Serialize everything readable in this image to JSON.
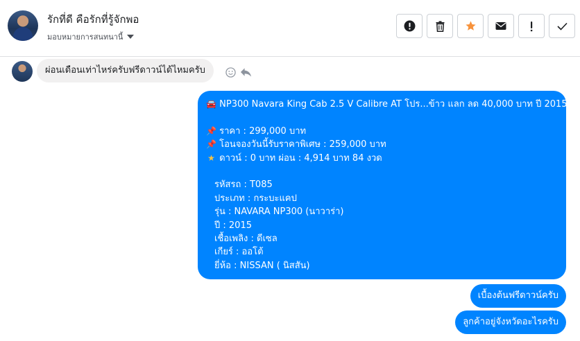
{
  "header": {
    "contact_name": "รักที่ดี คือรักที่รู้จักพอ",
    "assign_label": "มอบหมายการสนทนานี้",
    "actions": [
      {
        "name": "spam-button",
        "icon": "exclamation-circle-icon",
        "glyph": "❗"
      },
      {
        "name": "delete-button",
        "icon": "trash-icon",
        "glyph": "🗑"
      },
      {
        "name": "star-button",
        "icon": "star-icon",
        "glyph": "★"
      },
      {
        "name": "mark-unread-button",
        "icon": "envelope-icon",
        "glyph": "✉"
      },
      {
        "name": "follow-up-button",
        "icon": "exclamation-icon",
        "glyph": "!"
      },
      {
        "name": "done-button",
        "icon": "check-icon",
        "glyph": "✓"
      }
    ],
    "star_color": "#f7923b"
  },
  "thread": {
    "incoming": {
      "text": "ผ่อนเดือนเท่าไหร่ครับฟรีดาวน์ได้ไหมครับ",
      "icons": [
        "smiley-icon",
        "reply-icon"
      ]
    },
    "listing": {
      "title_icon": "car-icon",
      "title": "NP300 Navara King Cab 2.5 V Calibre AT โปร...ข้าว แลก ลด 40,000 บาท ปี 2015",
      "price_icon": "pushpin-icon",
      "price": "ราคา : 299,000 บาท",
      "special_icon": "pushpin-icon",
      "special": "โอนจองวันนี้รับราคาพิเศษ : 259,000 บาท",
      "down_icon": "star-icon",
      "down": "ดาวน์ : 0 บาท ผ่อน : 4,914 บาท 84 งวด",
      "details": [
        "รหัสรถ : T085",
        "ประเภท : กระบะแคป",
        "รุ่น : NAVARA NP300 (นาวาร่า)",
        "ปี : 2015",
        "เชื้อเพลิง : ดีเซล",
        "เกียร์ : ออโต้",
        "ยี่ห้อ : NISSAN ( นิสสัน)"
      ]
    },
    "reply1": "เบื้องต้นฟรีดาวน์ครับ",
    "reply2": "ลูกค้าอยู่จังหวัดอะไรครับ",
    "outgoing_color": "#0084ff",
    "incoming_color": "#f1f0f0"
  }
}
